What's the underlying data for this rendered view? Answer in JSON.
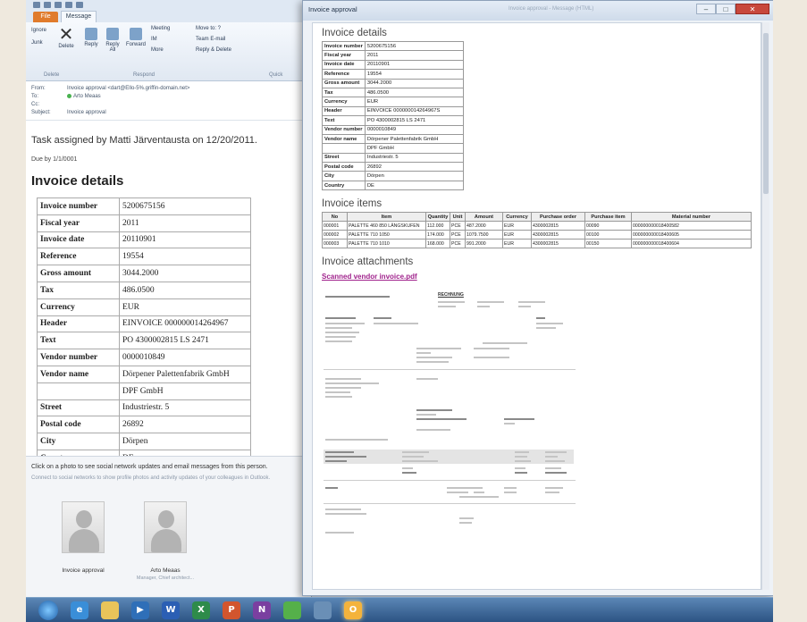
{
  "outlook": {
    "tabs": {
      "file": "File",
      "message": "Message"
    },
    "ribbon": {
      "ignore": "Ignore",
      "junk": "Junk",
      "delete": "Delete",
      "reply": "Reply",
      "reply_all": "Reply All",
      "forward": "Forward",
      "meeting": "Meeting",
      "im": "IM",
      "more": "More",
      "move_to": "Move to: ?",
      "team_email": "Team E-mail",
      "reply_delete": "Reply & Delete",
      "group_delete": "Delete",
      "group_respond": "Respond",
      "group_quick": "Quick"
    },
    "headers": {
      "from_label": "From:",
      "from_value": "Invoice approval <dart@Ello-5%.griffin-domain.net>",
      "to_label": "To:",
      "to_value": "Arto Meaas",
      "cc_label": "Cc:",
      "subject_label": "Subject:",
      "subject_value": "Invoice approval"
    },
    "task_line": "Task assigned by Matti Järventausta on 12/20/2011.",
    "due": "Due by 1/1/0001",
    "invoice_heading": "Invoice details",
    "invoice_rows": [
      {
        "k": "Invoice number",
        "v": "5200675156"
      },
      {
        "k": "Fiscal year",
        "v": "2011"
      },
      {
        "k": "Invoice date",
        "v": "20110901"
      },
      {
        "k": "Reference",
        "v": "19554"
      },
      {
        "k": "Gross amount",
        "v": "3044.2000"
      },
      {
        "k": "Tax",
        "v": "486.0500"
      },
      {
        "k": "Currency",
        "v": "EUR"
      },
      {
        "k": "Header",
        "v": "EINVOICE 000000014264967"
      },
      {
        "k": "Text",
        "v": "PO 4300002815 LS 2471"
      },
      {
        "k": "Vendor number",
        "v": "0000010849"
      },
      {
        "k": "Vendor name",
        "v": "Dörpener Palettenfabrik GmbH"
      },
      {
        "k": "",
        "v": "DPF GmbH"
      },
      {
        "k": "Street",
        "v": "Industriestr. 5"
      },
      {
        "k": "Postal code",
        "v": "26892"
      },
      {
        "k": "City",
        "v": "Dörpen"
      },
      {
        "k": "Country",
        "v": "DE"
      }
    ],
    "social": {
      "line1": "Click on a photo to see social network updates and email messages from this person.",
      "line2": "Connect to social networks to show profile photos and activity updates of your colleagues in Outlook.",
      "people": [
        {
          "name": "Invoice approval",
          "sub": ""
        },
        {
          "name": "Arto Meaas",
          "sub": "Manager, Chief architect..."
        }
      ]
    }
  },
  "invoice_window": {
    "title": "Invoice approval",
    "faded_title": "Invoice approval - Message (HTML)",
    "controls": {
      "min": "–",
      "max": "□",
      "close": "✕"
    },
    "details_heading": "Invoice details",
    "details_rows": [
      {
        "k": "Invoice number",
        "v": "5200675156"
      },
      {
        "k": "Fiscal year",
        "v": "2011"
      },
      {
        "k": "Invoice date",
        "v": "20110901"
      },
      {
        "k": "Reference",
        "v": "19554"
      },
      {
        "k": "Gross amount",
        "v": "3044.2000"
      },
      {
        "k": "Tax",
        "v": "486.0500"
      },
      {
        "k": "Currency",
        "v": "EUR"
      },
      {
        "k": "Header",
        "v": "EINVOICE 000000014264967S"
      },
      {
        "k": "Text",
        "v": "PO 4300002815 LS 2471"
      },
      {
        "k": "Vendor number",
        "v": "0000010849"
      },
      {
        "k": "Vendor name",
        "v": "Dörpener Palettenfabrik GmbH"
      },
      {
        "k": "",
        "v": "DPF GmbH"
      },
      {
        "k": "Street",
        "v": "Industriestr. 5"
      },
      {
        "k": "Postal code",
        "v": "26892"
      },
      {
        "k": "City",
        "v": "Dörpen"
      },
      {
        "k": "Country",
        "v": "DE"
      }
    ],
    "items_heading": "Invoice items",
    "items_columns": [
      "No",
      "Item",
      "Quantity",
      "Unit",
      "Amount",
      "Currency",
      "Purchase order",
      "Purchase item",
      "Material number"
    ],
    "items_rows": [
      [
        "000001",
        "PALETTE 460 850 LÄNGSKUFEN",
        "112.000",
        "PCE",
        "487.2000",
        "EUR",
        "4300002815",
        "00090",
        "000000000018400582"
      ],
      [
        "000002",
        "PALETTE 710 1050",
        "174.000",
        "PCE",
        "1079.7500",
        "EUR",
        "4300002815",
        "00100",
        "000000000018400605"
      ],
      [
        "000003",
        "PALETTE 710 1010",
        "168.000",
        "PCE",
        "991.2000",
        "EUR",
        "4300002815",
        "00150",
        "000000000018400604"
      ]
    ],
    "attachments_heading": "Invoice attachments",
    "attachment_link": "Scanned vendor invoice.pdf",
    "doc": {
      "title": "RECHNUNG",
      "sender": "Dörpener Palettenfabrik GmbH"
    }
  },
  "taskbar": {
    "icons": [
      "windows-start",
      "internet-explorer",
      "file-explorer",
      "media-player",
      "word",
      "excel",
      "powerpoint",
      "onenote",
      "messenger",
      "network",
      "outlook"
    ],
    "labels": [
      "",
      "e",
      "",
      "▶",
      "W",
      "X",
      "P",
      "N",
      "",
      "",
      "O"
    ]
  }
}
